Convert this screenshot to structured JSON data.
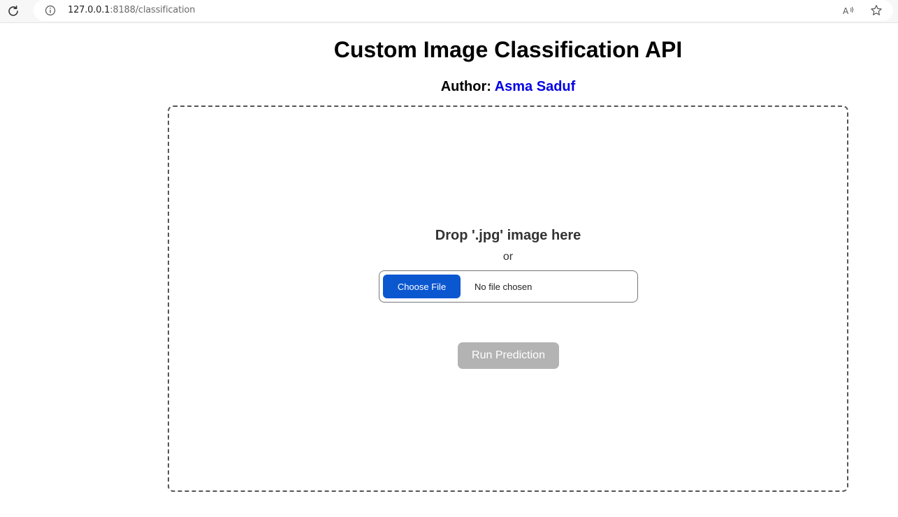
{
  "browser": {
    "url_host": "127.0.0.1",
    "url_rest": ":8188/classification"
  },
  "page": {
    "title": "Custom Image Classification API",
    "author_label": "Author: ",
    "author_name": "Asma Saduf"
  },
  "upload": {
    "drop_text": "Drop '.jpg' image here",
    "or_text": "or",
    "choose_file_label": "Choose File",
    "file_status": "No file chosen",
    "run_button_label": "Run Prediction"
  },
  "colors": {
    "author_name": "#0000e6",
    "choose_file_button": "#0b57d0",
    "run_button_disabled": "#b3b3b3"
  }
}
